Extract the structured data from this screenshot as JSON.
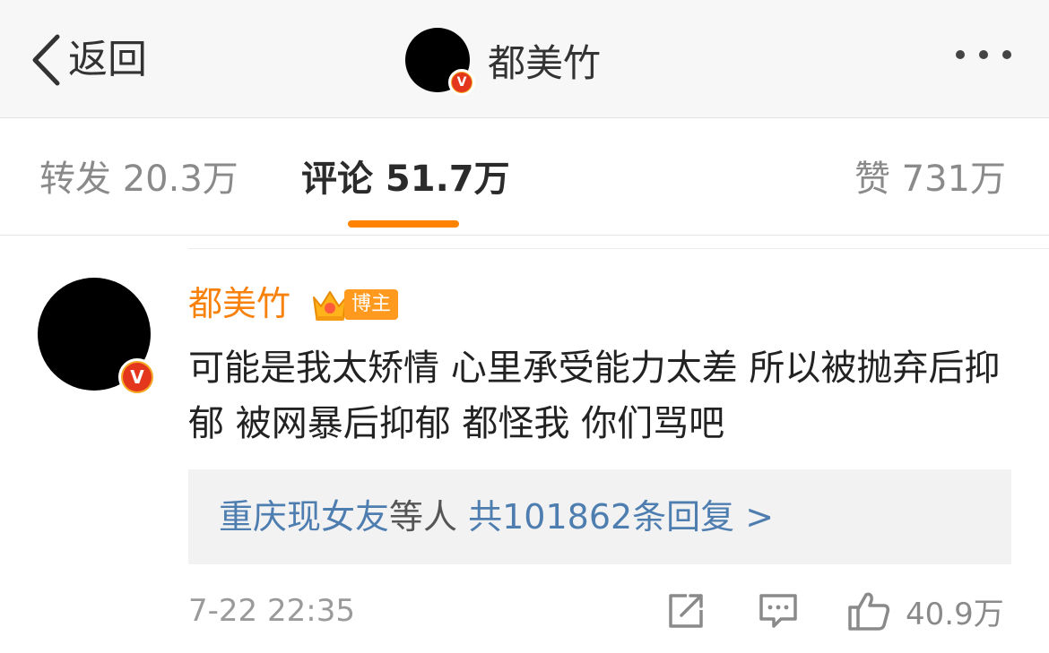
{
  "header": {
    "back_label": "返回",
    "user_name": "都美竹",
    "badge_text": "V"
  },
  "tabs": {
    "repost": "转发 20.3万",
    "comment": "评论 51.7万",
    "like": "赞 731万",
    "active_color": "#ff8200"
  },
  "comment": {
    "user_name": "都美竹",
    "user_badge_text": "V",
    "tag_label": "博主",
    "name_color": "#f7810b",
    "text": "可能是我太矫情 心里承受能力太差 所以被抛弃后抑郁 被网暴后抑郁 都怪我 你们骂吧",
    "replies": {
      "users": "重庆现女友",
      "middle": "等人",
      "count_text": "共101862条回复 >",
      "link_color": "#4e7db0"
    },
    "time": "7-22 22:35",
    "like_count": "40.9万"
  },
  "icons": [
    "chevron-left-icon",
    "more-dots-icon",
    "verified-badge-icon",
    "crown-icon",
    "share-icon",
    "comment-icon",
    "thumbs-up-icon"
  ]
}
